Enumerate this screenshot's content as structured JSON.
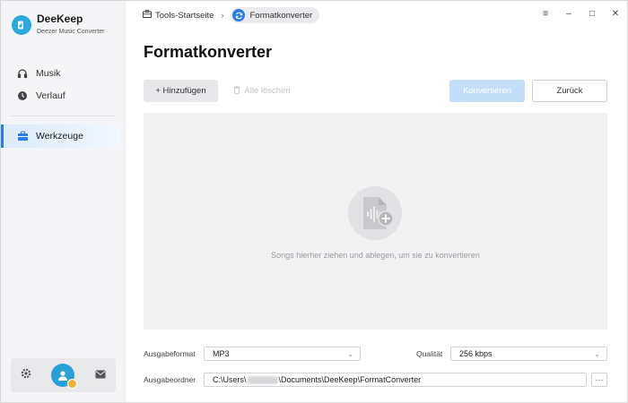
{
  "app": {
    "name": "DeeKeep",
    "subtitle": "Deezer Music Converter"
  },
  "sidebar": {
    "items": [
      {
        "label": "Musik",
        "icon": "headphones-icon"
      },
      {
        "label": "Verlauf",
        "icon": "clock-icon"
      },
      {
        "label": "Werkzeuge",
        "icon": "toolbox-icon",
        "active": true
      }
    ],
    "bottom_icons": [
      "gear-icon",
      "avatar",
      "mail-icon"
    ]
  },
  "breadcrumb": {
    "home": "Tools-Startseite",
    "current": "Formatkonverter"
  },
  "page": {
    "title": "Formatkonverter"
  },
  "toolbar": {
    "add_label": "+ Hinzufügen",
    "clear_label": "Alle löschen",
    "convert_label": "Konvertieren",
    "back_label": "Zurück"
  },
  "dropzone": {
    "hint": "Songs hierher ziehen und ablegen, um sie zu konvertieren"
  },
  "settings": {
    "format_label": "Ausgabeformat",
    "format_value": "MP3",
    "quality_label": "Qualität",
    "quality_value": "256 kbps",
    "folder_label": "Ausgabeordner",
    "folder_prefix": "C:\\Users\\",
    "folder_suffix": "\\Documents\\DeeKeep\\FormatConverter",
    "browse_label": "···"
  },
  "colors": {
    "accent": "#2b7de9",
    "brand": "#2aa8e0",
    "convert_disabled": "#c4ddf9"
  }
}
